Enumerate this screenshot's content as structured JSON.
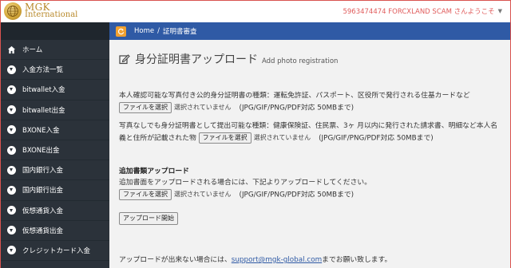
{
  "header": {
    "logo_line1": "MGK",
    "logo_line2": "International",
    "user_text": "5963474474 FORCXLAND SCAM さんようこそ",
    "logo_icon": "globe-icon",
    "colors": {
      "accent": "#2f5aa5",
      "sidebar": "#2b323a",
      "gold": "#b8892a"
    }
  },
  "sidebar": {
    "items": [
      {
        "label": "ホーム",
        "icon": "home-icon"
      },
      {
        "label": "入金方法一覧",
        "icon": "circle-down-icon"
      },
      {
        "label": "bitwallet入金",
        "icon": "circle-down-icon"
      },
      {
        "label": "bitwallet出金",
        "icon": "circle-down-icon"
      },
      {
        "label": "BXONE入金",
        "icon": "circle-down-icon"
      },
      {
        "label": "BXONE出金",
        "icon": "circle-down-icon"
      },
      {
        "label": "国内銀行入金",
        "icon": "circle-down-icon"
      },
      {
        "label": "国内銀行出金",
        "icon": "circle-down-icon"
      },
      {
        "label": "仮想通貨入金",
        "icon": "circle-down-icon"
      },
      {
        "label": "仮想通貨出金",
        "icon": "circle-down-icon"
      },
      {
        "label": "クレジットカード入金",
        "icon": "circle-down-icon"
      }
    ]
  },
  "breadcrumb": {
    "home": "Home",
    "separator": "/",
    "current": "証明書審査"
  },
  "main": {
    "title": "身分証明書アップロード",
    "subtitle": "Add photo registration",
    "section1": {
      "text": "本人確認可能な写真付き公的身分証明書の種類：運転免許証、パスポート、区役所で発行される住基カードなど",
      "button": "ファイルを選択",
      "status": "選択されていません",
      "note": "(JPG/GIF/PNG/PDF対応 50MBまで)"
    },
    "section2": {
      "text": "写真なしでも身分証明書として提出可能な種類：健康保険証、住民票、3ヶ 月以内に発行された請求書、明細など本人名義と住所が記載された物",
      "button": "ファイルを選択",
      "status": "選択されていません",
      "note": "(JPG/GIF/PNG/PDF対応 50MBまで)"
    },
    "section3": {
      "title": "追加書類アップロード",
      "text": "追加書面をアップロードされる場合には、下記よりアップロードしてください。",
      "button": "ファイルを選択",
      "status": "選択されていません",
      "note": "(JPG/GIF/PNG/PDF対応 50MBまで)"
    },
    "upload_button": "アップロード開始",
    "footer": {
      "prefix": "アップロードが出来ない場合には、",
      "email": "support@mgk-global.com",
      "suffix": "までお願い致します。"
    }
  }
}
